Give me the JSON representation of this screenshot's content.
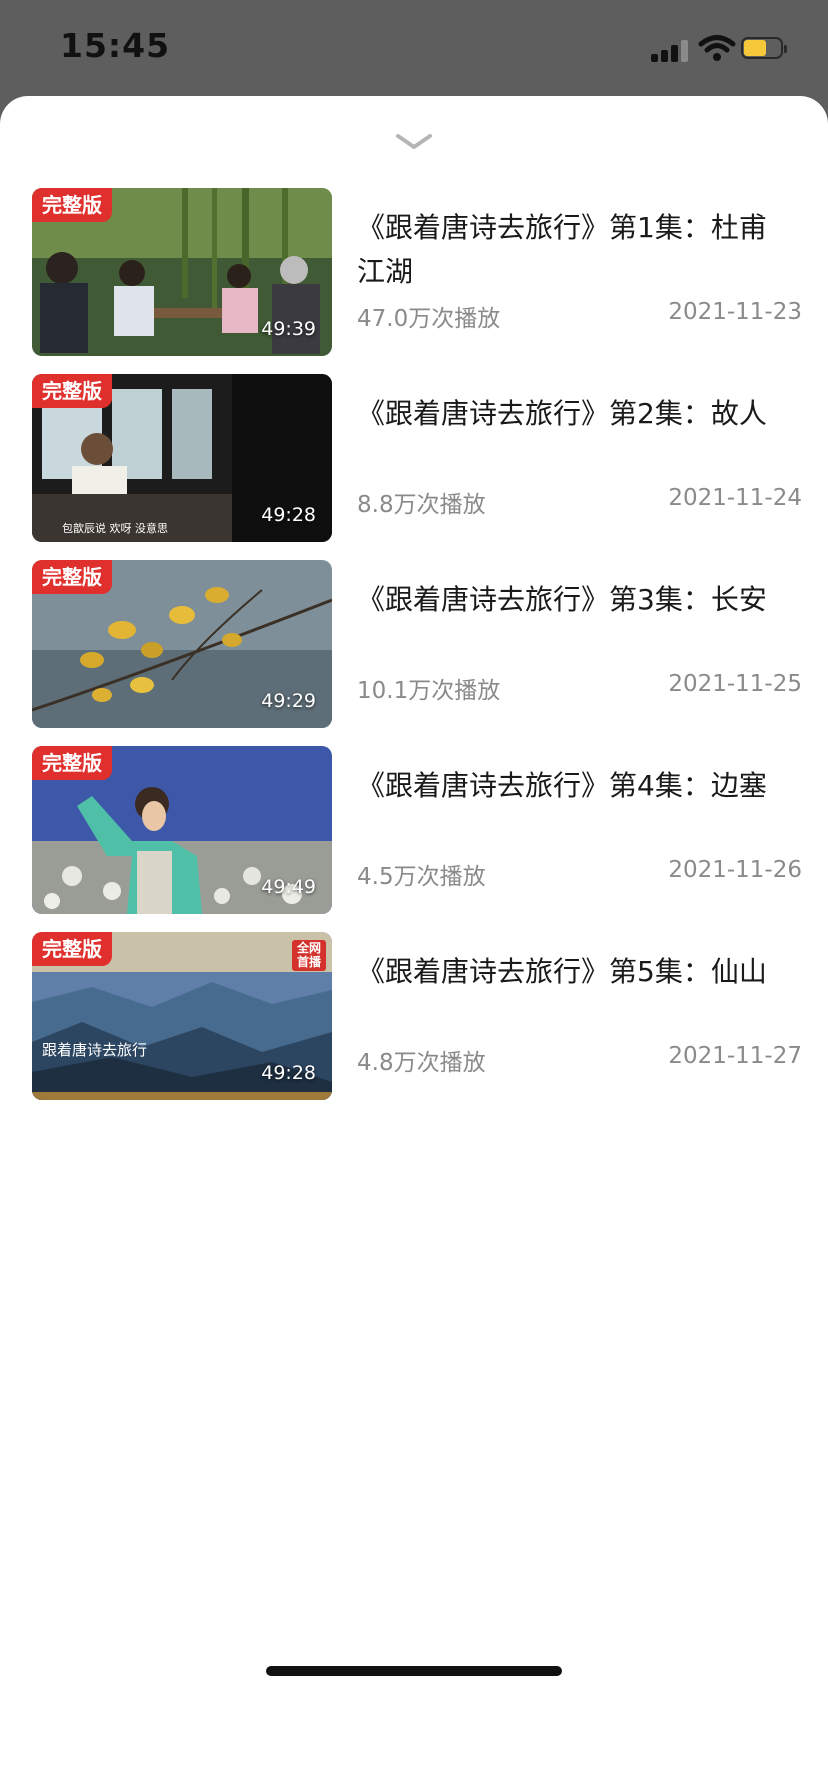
{
  "status_bar": {
    "time": "15:45",
    "battery_color": "#f6c93b"
  },
  "sheet": {
    "collapse_icon": "chevron-down-icon"
  },
  "episodes": [
    {
      "badge": "完整版",
      "duration": "49:39",
      "title": "《跟着唐诗去旅行》第1集：杜甫 江湖",
      "views": "47.0万次播放",
      "date": "2021-11-23"
    },
    {
      "badge": "完整版",
      "duration": "49:28",
      "title": "《跟着唐诗去旅行》第2集：故人",
      "views": "8.8万次播放",
      "date": "2021-11-24",
      "caption": "包歆辰说 欢呀 没意思"
    },
    {
      "badge": "完整版",
      "duration": "49:29",
      "title": "《跟着唐诗去旅行》第3集：长安",
      "views": "10.1万次播放",
      "date": "2021-11-25"
    },
    {
      "badge": "完整版",
      "duration": "49:49",
      "title": "《跟着唐诗去旅行》第4集：边塞",
      "views": "4.5万次播放",
      "date": "2021-11-26"
    },
    {
      "badge": "完整版",
      "duration": "49:28",
      "title": "《跟着唐诗去旅行》第5集：仙山",
      "views": "4.8万次播放",
      "date": "2021-11-27",
      "overlay_tag": "全网首播",
      "overlay_logo": "跟着唐诗去旅行"
    }
  ],
  "colors": {
    "badge": "#e0302e",
    "meta_text": "#8a8a8a",
    "title_text": "#1a1a1a"
  }
}
